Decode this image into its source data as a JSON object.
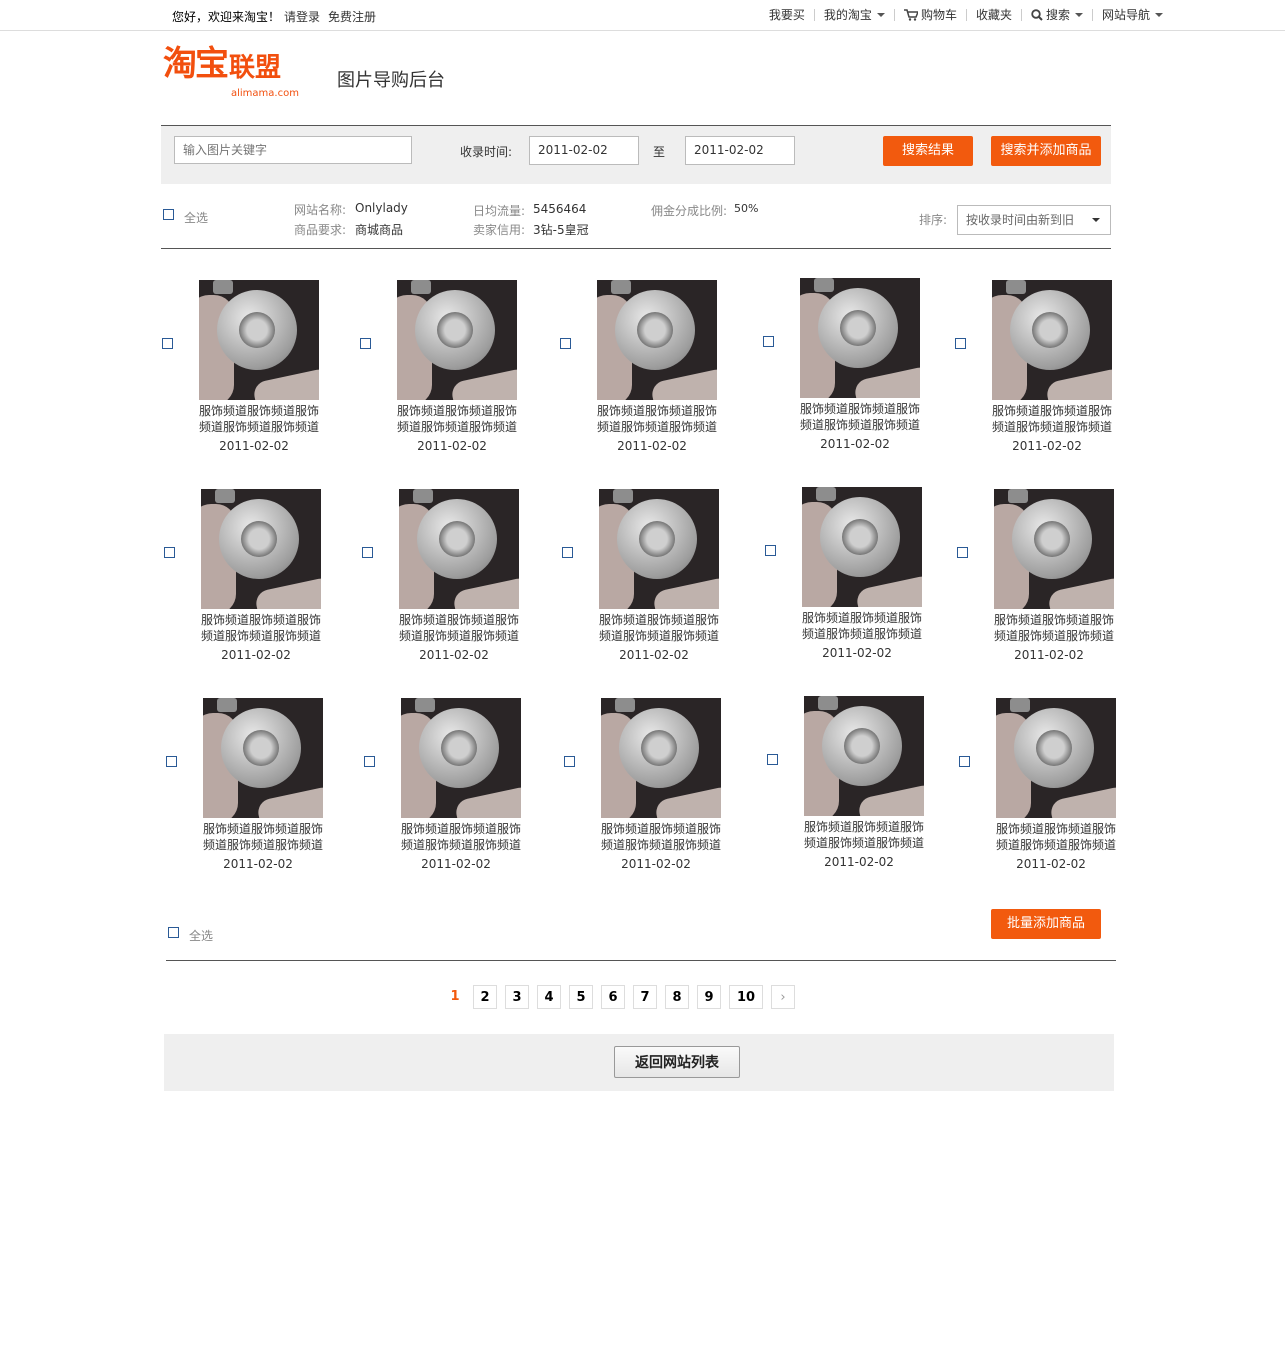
{
  "topbar": {
    "greeting": "您好，欢迎来淘宝！",
    "login": "请登录",
    "register": "免费注册",
    "links": [
      "我要买",
      "我的淘宝",
      "购物车",
      "收藏夹",
      "搜索",
      "网站导航"
    ]
  },
  "brand": {
    "logo_main": "淘宝",
    "logo_side": "联盟",
    "logo_domain": "alimama.com",
    "subtitle": "图片导购后台"
  },
  "search": {
    "keyword_placeholder": "输入图片关键字",
    "time_label": "收录时间:",
    "date_from": "2011-02-02",
    "to_label": "至",
    "date_to": "2011-02-02",
    "search_button": "搜索结果",
    "search_add_button": "搜索并添加商品"
  },
  "info": {
    "select_all": "全选",
    "site_name_label": "网站名称:",
    "site_name": "Onlylady",
    "goods_req_label": "商品要求:",
    "goods_req": "商城商品",
    "traffic_label": "日均流量:",
    "traffic": "5456464",
    "credit_label": "卖家信用:",
    "credit": "3钻-5皇冠",
    "commission_label": "佣金分成比例:",
    "commission": "50%",
    "sort_label": "排序:",
    "sort_value": "按收录时间由新到旧"
  },
  "items": [
    {
      "caption": "服饰频道服饰频道服饰频道服饰频道服饰频道",
      "date": "2011-02-02"
    },
    {
      "caption": "服饰频道服饰频道服饰频道服饰频道服饰频道",
      "date": "2011-02-02"
    },
    {
      "caption": "服饰频道服饰频道服饰频道服饰频道服饰频道",
      "date": "2011-02-02"
    },
    {
      "caption": "服饰频道服饰频道服饰频道服饰频道服饰频道",
      "date": "2011-02-02"
    },
    {
      "caption": "服饰频道服饰频道服饰频道服饰频道服饰频道",
      "date": "2011-02-02"
    },
    {
      "caption": "服饰频道服饰频道服饰频道服饰频道服饰频道",
      "date": "2011-02-02"
    },
    {
      "caption": "服饰频道服饰频道服饰频道服饰频道服饰频道",
      "date": "2011-02-02"
    },
    {
      "caption": "服饰频道服饰频道服饰频道服饰频道服饰频道",
      "date": "2011-02-02"
    },
    {
      "caption": "服饰频道服饰频道服饰频道服饰频道服饰频道",
      "date": "2011-02-02"
    },
    {
      "caption": "服饰频道服饰频道服饰频道服饰频道服饰频道",
      "date": "2011-02-02"
    },
    {
      "caption": "服饰频道服饰频道服饰频道服饰频道服饰频道",
      "date": "2011-02-02"
    },
    {
      "caption": "服饰频道服饰频道服饰频道服饰频道服饰频道",
      "date": "2011-02-02"
    },
    {
      "caption": "服饰频道服饰频道服饰频道服饰频道服饰频道",
      "date": "2011-02-02"
    },
    {
      "caption": "服饰频道服饰频道服饰频道服饰频道服饰频道",
      "date": "2011-02-02"
    },
    {
      "caption": "服饰频道服饰频道服饰频道服饰频道服饰频道",
      "date": "2011-02-02"
    }
  ],
  "bulk": {
    "select_all": "全选",
    "batch_add_button": "批量添加商品"
  },
  "pagination": {
    "pages": [
      "1",
      "2",
      "3",
      "4",
      "5",
      "6",
      "7",
      "8",
      "9",
      "10"
    ],
    "current": "1",
    "next": "›"
  },
  "footer": {
    "back_button": "返回网站列表"
  },
  "colors": {
    "accent": "#f25a0e",
    "checkbox": "#2a5a96",
    "panel": "#efefef"
  }
}
